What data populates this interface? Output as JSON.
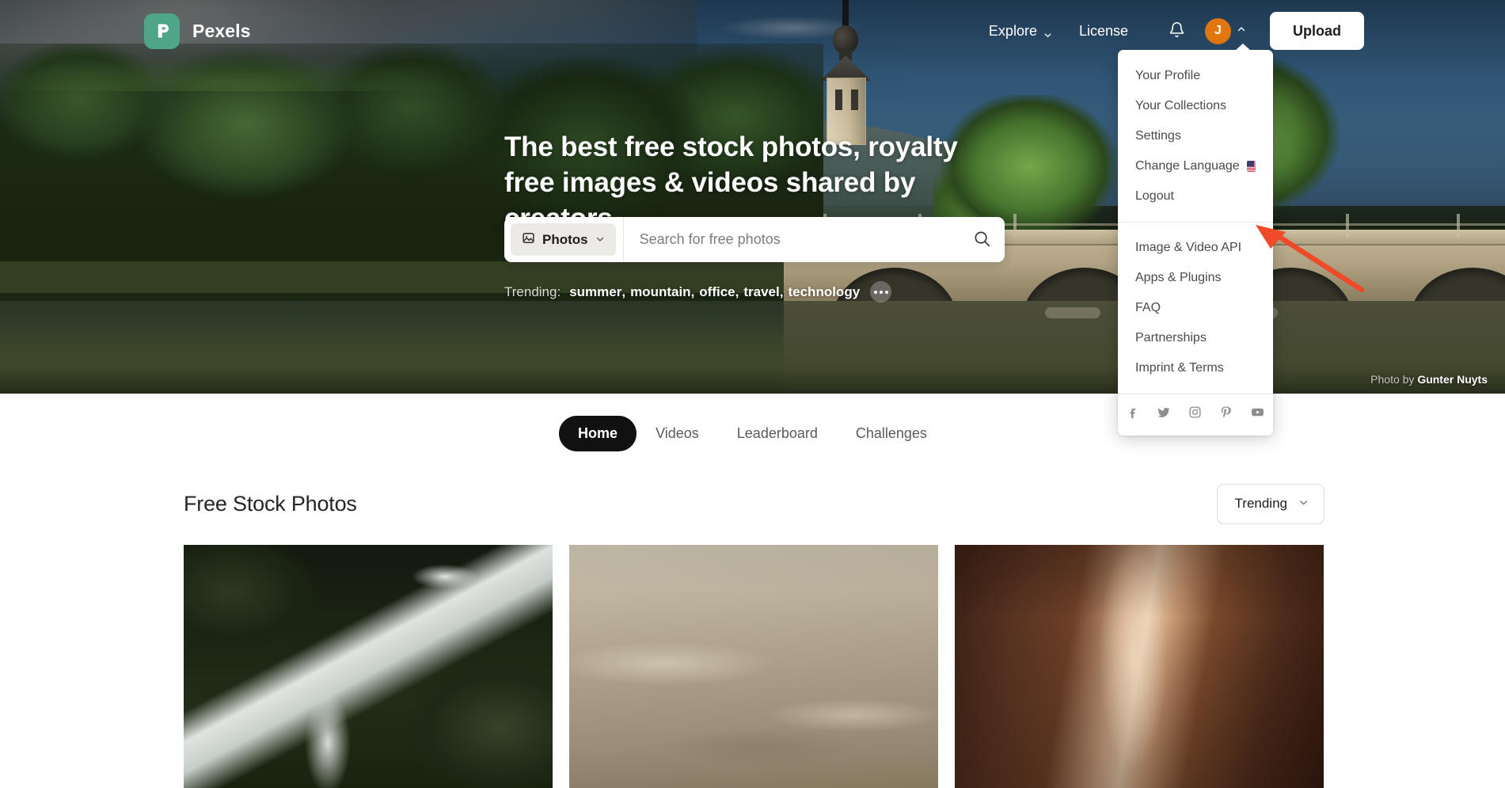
{
  "brand": {
    "name": "Pexels",
    "logo_icon": "pexels-p-logo",
    "accent_color": "#4fa588"
  },
  "topnav": {
    "explore": "Explore",
    "license": "License",
    "bell_icon": "bell-icon",
    "avatar_initial": "J",
    "avatar_color": "#e2760f",
    "upload": "Upload",
    "chevron_down_icon": "chevron-down-icon",
    "chevron_up_icon": "chevron-up-icon"
  },
  "user_menu": {
    "items": [
      {
        "label": "Your Profile",
        "icon": ""
      },
      {
        "label": "Your Collections",
        "icon": ""
      },
      {
        "label": "Settings",
        "icon": ""
      },
      {
        "label": "Change Language",
        "icon": "us-flag-icon"
      },
      {
        "label": "Logout",
        "icon": ""
      }
    ],
    "items2": [
      {
        "label": "Image & Video API"
      },
      {
        "label": "Apps & Plugins"
      },
      {
        "label": "FAQ"
      },
      {
        "label": "Partnerships"
      },
      {
        "label": "Imprint & Terms"
      }
    ],
    "social": [
      {
        "name": "facebook-icon",
        "glyph": "f"
      },
      {
        "name": "twitter-icon",
        "glyph": "t"
      },
      {
        "name": "instagram-icon",
        "glyph": "i"
      },
      {
        "name": "pinterest-icon",
        "glyph": "P"
      },
      {
        "name": "youtube-icon",
        "glyph": "y"
      }
    ]
  },
  "hero": {
    "title": "The best free stock photos, royalty free images & videos shared by creators.",
    "photo_credit_prefix": "Photo by",
    "photo_credit_author": "Gunter Nuyts"
  },
  "search": {
    "type_label": "Photos",
    "type_icon": "image-icon",
    "placeholder": "Search for free photos",
    "value": "",
    "search_icon": "search-icon"
  },
  "trending": {
    "label": "Trending:",
    "terms": [
      "summer",
      "mountain",
      "office",
      "travel",
      "technology"
    ],
    "more_icon": "ellipsis-icon"
  },
  "tabs": [
    {
      "label": "Home",
      "active": true
    },
    {
      "label": "Videos",
      "active": false
    },
    {
      "label": "Leaderboard",
      "active": false
    },
    {
      "label": "Challenges",
      "active": false
    }
  ],
  "section": {
    "title": "Free Stock Photos",
    "sort_value": "Trending",
    "sort_icon": "chevron-down-icon"
  },
  "photos": [
    {
      "alt": "waterfall in dark green forest"
    },
    {
      "alt": "hazy aerial view of hillside city"
    },
    {
      "alt": "sunlit red sandstone slot canyon"
    }
  ],
  "annotation": {
    "type": "arrow",
    "color": "#f04a28",
    "points_to": "Image & Video API"
  }
}
